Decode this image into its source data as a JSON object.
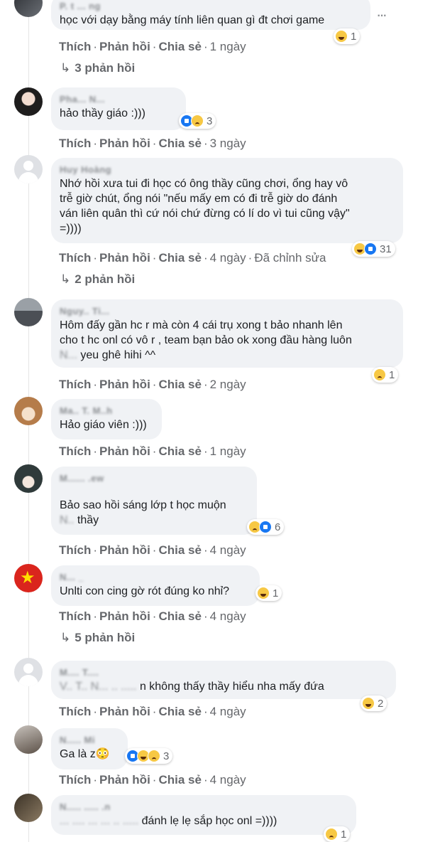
{
  "comments": [
    {
      "author": "P. t ... ng",
      "text": "học với dạy bằng máy tính liên quan gì đt chơi game",
      "reactions": {
        "icons": [
          "haha"
        ],
        "count": "1"
      },
      "actions": {
        "like": "Thích",
        "reply": "Phản hồi",
        "share": "Chia sẻ",
        "time": "1 ngày"
      },
      "replies": "3 phản hồi",
      "more_icon": "···"
    },
    {
      "author": "Pha... N...",
      "text": "hảo thầy giáo :)))",
      "reactions": {
        "icons": [
          "like",
          "sad"
        ],
        "count": "3"
      },
      "actions": {
        "like": "Thích",
        "reply": "Phản hồi",
        "share": "Chia sẻ",
        "time": "3 ngày"
      }
    },
    {
      "author": "Huy Hoàng",
      "text": "Nhớ hồi xưa tui đi học có ông thầy cũng chơi, ổng hay vô\ntrễ giờ chút, ổng nói \"nếu mấy em có đi trễ giờ do đánh\nván liên quân thì cứ nói chứ đừng có lí do vì tui cũng vậy\"\n=))))",
      "reactions": {
        "icons": [
          "haha",
          "like"
        ],
        "count": "31"
      },
      "actions": {
        "like": "Thích",
        "reply": "Phản hồi",
        "share": "Chia sẻ",
        "time": "4 ngày",
        "edited": "Đã chỉnh sửa"
      },
      "replies": "2 phản hồi"
    },
    {
      "author": "Nguy.. Ti...",
      "text": "Hôm đấy gần hc r mà còn 4 cái trụ xong t bảo nhanh lên\ncho t hc onl có vô r , team bạn bảo ok xong đầu hàng luôn",
      "text_mention": "N... ",
      "text_tail": "yeu ghê hihi ^^",
      "reactions": {
        "icons": [
          "sad"
        ],
        "count": "1"
      },
      "actions": {
        "like": "Thích",
        "reply": "Phản hồi",
        "share": "Chia sẻ",
        "time": "2 ngày"
      }
    },
    {
      "author": "Ma.. T. M..h",
      "text": "Hảo giáo viên :)))",
      "actions": {
        "like": "Thích",
        "reply": "Phản hồi",
        "share": "Chia sẻ",
        "time": "1 ngày"
      }
    },
    {
      "author": "M...... .ew",
      "text": "Bảo sao hồi sáng lớp t học muộn",
      "text_mention": "N.. ",
      "text_tail": "thầy",
      "reactions": {
        "icons": [
          "sad",
          "like"
        ],
        "count": "6"
      },
      "actions": {
        "like": "Thích",
        "reply": "Phản hồi",
        "share": "Chia sẻ",
        "time": "4 ngày"
      }
    },
    {
      "author": "N... _",
      "text": "Unlti con cing gờ rót đúng ko nhỉ?",
      "reactions": {
        "icons": [
          "haha"
        ],
        "count": "1"
      },
      "actions": {
        "like": "Thích",
        "reply": "Phản hồi",
        "share": "Chia sẻ",
        "time": "4 ngày"
      },
      "replies": "5 phản hồi"
    },
    {
      "author": "M.... T....",
      "text_mention": "V.. T.. N... .. ..... ",
      "text_tail": "n không thấy thầy hiểu nha mấy đứa",
      "reactions": {
        "icons": [
          "haha"
        ],
        "count": "2"
      },
      "actions": {
        "like": "Thích",
        "reply": "Phản hồi",
        "share": "Chia sẻ",
        "time": "4 ngày"
      }
    },
    {
      "author": "N..... Mi",
      "text": "Ga là z😳",
      "reactions": {
        "icons": [
          "like",
          "haha",
          "sad"
        ],
        "count": "3"
      },
      "actions": {
        "like": "Thích",
        "reply": "Phản hồi",
        "share": "Chia sẻ",
        "time": "4 ngày"
      }
    },
    {
      "author": "N..... ..... .n",
      "text_mention": "... .... ... ... .. ..... ",
      "text_tail": "đánh lẹ lẹ sắp học onl =))))",
      "reactions": {
        "icons": [
          "sad"
        ],
        "count": "1"
      }
    }
  ]
}
